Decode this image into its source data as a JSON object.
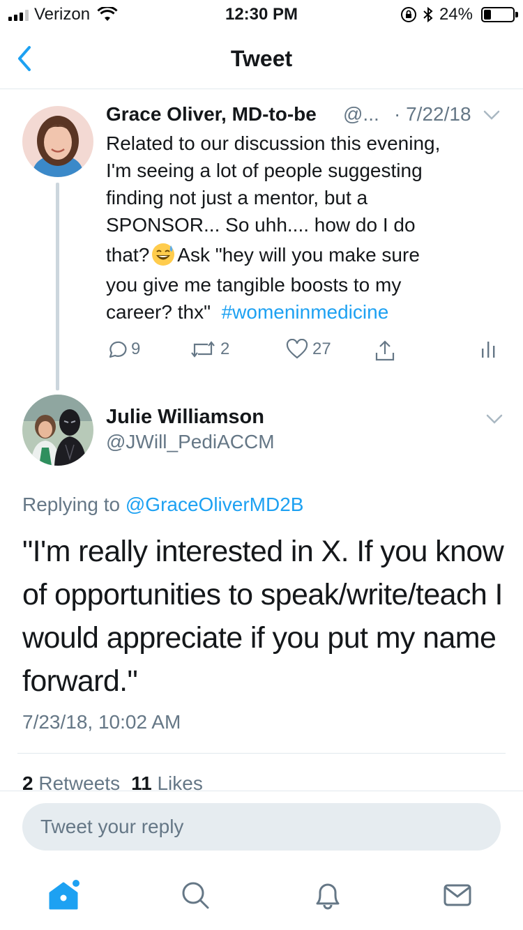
{
  "status_bar": {
    "carrier": "Verizon",
    "time": "12:30 PM",
    "battery_percent": "24%",
    "battery_level": 0.24
  },
  "nav": {
    "title": "Tweet",
    "back_icon": "chevron-left-icon"
  },
  "original_tweet": {
    "author_name": "Grace Oliver, MD-to-be",
    "author_handle": "@...",
    "date": "· 7/22/18",
    "text_lines": [
      "Related to our discussion this evening,",
      "I'm seeing a lot of people suggesting",
      "finding not just a mentor, but a",
      "SPONSOR... So uhh.... how do I do"
    ],
    "line5_before_emoji": "that?",
    "line5_after_emoji": "Ask \"hey will you make sure",
    "line6": "you give me tangible boosts to my",
    "line7": "career? thx\"",
    "hashtag": "#womeninmedicine",
    "emoji": "grinning-face-with-sweat-icon",
    "reply_count": "9",
    "retweet_count": "2",
    "like_count": "27"
  },
  "reply_tweet": {
    "author_name": "Julie Williamson",
    "author_handle": "@JWill_PediACCM",
    "replying_to_label": "Replying to",
    "replying_to_handle": "@GraceOliverMD2B",
    "text_lines": [
      "\"I'm really interested in X.  If you know",
      "of opportunities to speak/write/teach I",
      "would appreciate if you put my name",
      "forward.\""
    ],
    "timestamp": "7/23/18, 10:02 AM",
    "retweets_count": "2",
    "retweets_label": "Retweets",
    "likes_count": "11",
    "likes_label": "Likes"
  },
  "composer": {
    "placeholder": "Tweet your reply"
  },
  "tab_bar": {
    "tabs": [
      "home-icon",
      "search-icon",
      "bell-icon",
      "mail-icon"
    ]
  },
  "colors": {
    "accent": "#1da1f2",
    "secondary_text": "#657786",
    "primary_text": "#14171a",
    "divider": "#e1e8ed",
    "input_bg": "#e6ecf0"
  }
}
